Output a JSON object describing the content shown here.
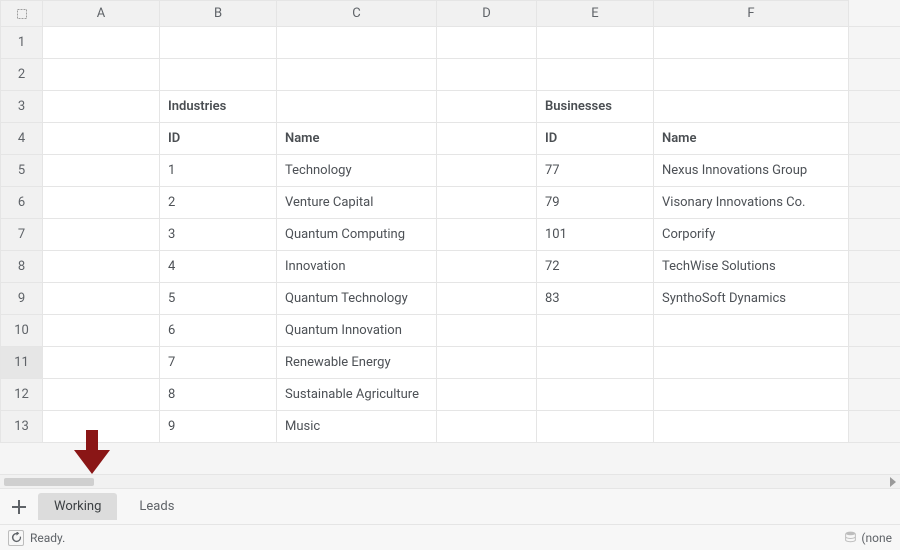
{
  "columns": [
    "A",
    "B",
    "C",
    "D",
    "E",
    "F"
  ],
  "rowCount": 13,
  "selectedRow": 11,
  "cells": {
    "r3": {
      "B": "Industries",
      "E": "Businesses"
    },
    "r4": {
      "B": "ID",
      "C": "Name",
      "E": "ID",
      "F": "Name"
    },
    "r5": {
      "B": "1",
      "C": "Technology",
      "E": "77",
      "F": "Nexus Innovations Group"
    },
    "r6": {
      "B": "2",
      "C": "Venture Capital",
      "E": "79",
      "F": "Visonary Innovations Co."
    },
    "r7": {
      "B": "3",
      "C": "Quantum Computing",
      "E": "101",
      "F": "Corporify"
    },
    "r8": {
      "B": "4",
      "C": "Innovation",
      "E": "72",
      "F": "TechWise Solutions"
    },
    "r9": {
      "B": "5",
      "C": "Quantum Technology",
      "E": "83",
      "F": "SynthoSoft Dynamics"
    },
    "r10": {
      "B": "6",
      "C": "Quantum Innovation"
    },
    "r11": {
      "B": "7",
      "C": "Renewable Energy"
    },
    "r12": {
      "B": "8",
      "C": "Sustainable Agriculture"
    },
    "r13": {
      "B": "9",
      "C": "Music"
    }
  },
  "sheetTabs": {
    "active": "Working",
    "other": "Leads"
  },
  "status": {
    "text": "Ready.",
    "right": "(none"
  }
}
